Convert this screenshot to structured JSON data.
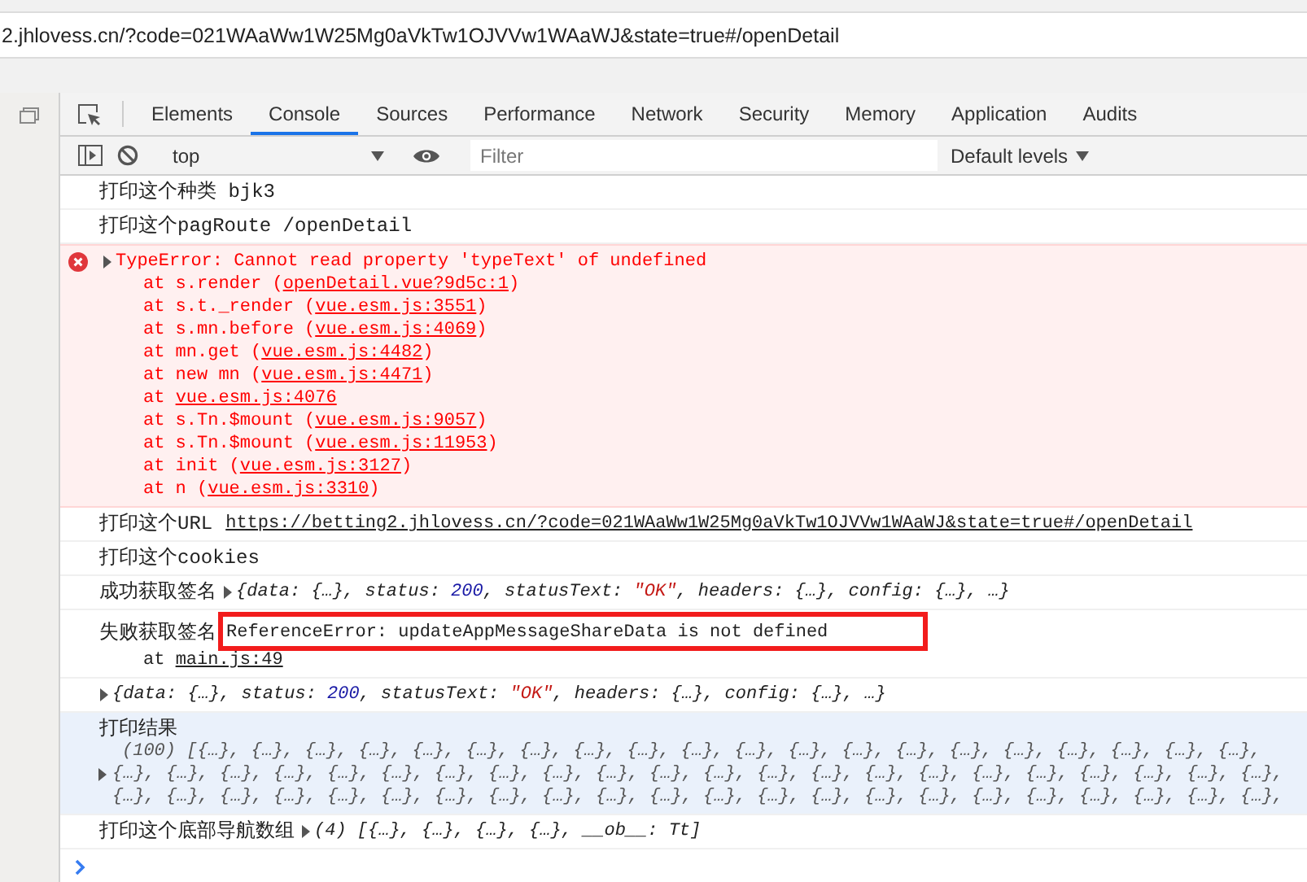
{
  "address_bar": {
    "url": "2.jhlovess.cn/?code=021WAaWw1W25Mg0aVkTw1OJVVw1WAaWJ&state=true#/openDetail"
  },
  "devtools": {
    "tabs": [
      {
        "label": "Elements",
        "selected": false
      },
      {
        "label": "Console",
        "selected": true
      },
      {
        "label": "Sources",
        "selected": false
      },
      {
        "label": "Performance",
        "selected": false
      },
      {
        "label": "Network",
        "selected": false
      },
      {
        "label": "Security",
        "selected": false
      },
      {
        "label": "Memory",
        "selected": false
      },
      {
        "label": "Application",
        "selected": false
      },
      {
        "label": "Audits",
        "selected": false
      }
    ],
    "toolbar": {
      "context": "top",
      "filter_placeholder": "Filter",
      "levels": "Default levels"
    }
  },
  "console": {
    "messages": [
      {
        "kind": "log",
        "text": "打印这个种类 bjk3"
      },
      {
        "kind": "log",
        "text": "打印这个pagRoute /openDetail"
      },
      {
        "kind": "error",
        "expanded": false,
        "text": "TypeError: Cannot read property 'typeText' of undefined",
        "stack": [
          {
            "prefix": "at s.render (",
            "link": "openDetail.vue?9d5c:1",
            "suffix": ")"
          },
          {
            "prefix": "at s.t._render (",
            "link": "vue.esm.js:3551",
            "suffix": ")"
          },
          {
            "prefix": "at s.mn.before (",
            "link": "vue.esm.js:4069",
            "suffix": ")"
          },
          {
            "prefix": "at mn.get (",
            "link": "vue.esm.js:4482",
            "suffix": ")"
          },
          {
            "prefix": "at new mn (",
            "link": "vue.esm.js:4471",
            "suffix": ")"
          },
          {
            "prefix": "at ",
            "link": "vue.esm.js:4076"
          },
          {
            "prefix": "at s.Tn.$mount (",
            "link": "vue.esm.js:9057",
            "suffix": ")"
          },
          {
            "prefix": "at s.Tn.$mount (",
            "link": "vue.esm.js:11953",
            "suffix": ")"
          },
          {
            "prefix": "at init (",
            "link": "vue.esm.js:3127",
            "suffix": ")"
          },
          {
            "prefix": "at n (",
            "link": "vue.esm.js:3310",
            "suffix": ")"
          }
        ]
      },
      {
        "kind": "log",
        "text": "打印这个URL",
        "link": "https://betting2.jhlovess.cn/?code=021WAaWw1W25Mg0aVkTw1OJVVw1WAaWJ&state=true#/openDetail"
      },
      {
        "kind": "log",
        "text": "打印这个cookies"
      },
      {
        "kind": "object",
        "text": "成功获取签名",
        "expanded": false,
        "preview": [
          {
            "kind": "plain",
            "text": "{data: {…}, status: "
          },
          {
            "kind": "number",
            "text": "200"
          },
          {
            "kind": "plain",
            "text": ", statusText: "
          },
          {
            "kind": "string",
            "text": "\"OK\""
          },
          {
            "kind": "plain",
            "text": ", headers: {…}, config: {…}, …}"
          }
        ]
      },
      {
        "kind": "trace",
        "text": "失败获取签名",
        "annotated": true,
        "message": "ReferenceError: updateAppMessageShareData is not defined",
        "stack": [
          {
            "prefix": "at ",
            "link": "main.js:49"
          }
        ]
      },
      {
        "kind": "object",
        "expanded": false,
        "preview": [
          {
            "kind": "plain",
            "text": "{data: {…}, status: "
          },
          {
            "kind": "number",
            "text": "200"
          },
          {
            "kind": "plain",
            "text": ", statusText: "
          },
          {
            "kind": "string",
            "text": "\"OK\""
          },
          {
            "kind": "plain",
            "text": ", headers: {…}, config: {…}, …}"
          }
        ]
      },
      {
        "kind": "array",
        "text": "打印结果",
        "expanded": false,
        "highlighted": true,
        "lines": [
          "(100) [{…}, {…}, {…}, {…}, {…}, {…}, {…}, {…}, {…}, {…}, {…}, {…}, {…}, {…}, {…}, {…}, {…}, {…}, {…}, {…},",
          "{…}, {…}, {…}, {…}, {…}, {…}, {…}, {…}, {…}, {…}, {…}, {…}, {…}, {…}, {…}, {…}, {…}, {…}, {…}, {…}, {…}, {…},",
          "{…}, {…}, {…}, {…}, {…}, {…}, {…}, {…}, {…}, {…}, {…}, {…}, {…}, {…}, {…}, {…}, {…}, {…}, {…}, {…}, {…}, {…},"
        ]
      },
      {
        "kind": "object",
        "text": "打印这个底部导航数组",
        "expanded": false,
        "preview": [
          {
            "kind": "plain",
            "text": "(4) [{…}, {…}, {…}, {…}, __ob__: Tt]"
          }
        ]
      }
    ]
  }
}
